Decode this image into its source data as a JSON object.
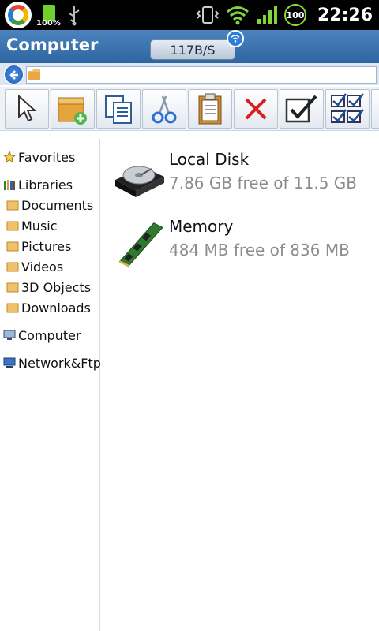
{
  "status_bar": {
    "battery_small_pct": "100%",
    "battery_circle": "100",
    "time": "22:26"
  },
  "titlebar": {
    "title": "Computer",
    "speed": "117B/S"
  },
  "address": {
    "value": ""
  },
  "toolbar": {
    "buttons": [
      "select-icon",
      "new-folder-icon",
      "copy-icon",
      "cut-icon",
      "paste-icon",
      "delete-icon",
      "check-icon",
      "check-all-icon"
    ]
  },
  "sidebar": {
    "favorites": "Favorites",
    "libraries": "Libraries",
    "documents": "Documents",
    "music": "Music",
    "pictures": "Pictures",
    "videos": "Videos",
    "objects3d": "3D Objects",
    "downloads": "Downloads",
    "computer": "Computer",
    "network": "Network&Ftp"
  },
  "drives": [
    {
      "name": "Local Disk",
      "info": "7.86 GB free of 11.5 GB"
    },
    {
      "name": "Memory",
      "info": "484 MB free of 836 MB"
    }
  ],
  "colors": {
    "titlebar": "#2c65a1",
    "drive_info": "#8c8c8c"
  }
}
